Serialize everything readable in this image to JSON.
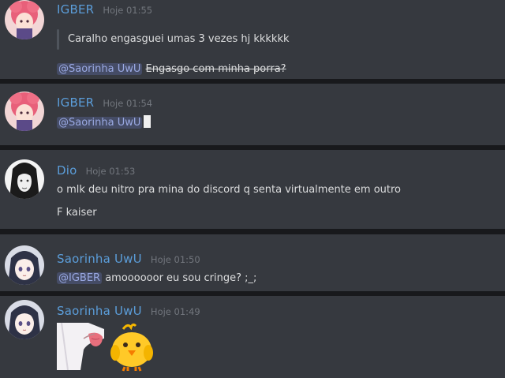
{
  "messages": [
    {
      "username": "IGBER",
      "timestamp": "Hoje 01:55",
      "quote": "Caralho engasguei umas 3 vezes hj kkkkkk",
      "mention": "@Saorinha UwU",
      "strikethrough": "Engasgo com minha porra?"
    },
    {
      "username": "IGBER",
      "timestamp": "Hoje 01:54",
      "mention": "@Saorinha UwU",
      "emoji_suffix": "❤️"
    },
    {
      "username": "Dio",
      "timestamp": "Hoje 01:53",
      "lines": [
        "o mlk deu nitro pra mina do discord  q senta virtualmente em outro",
        "F kaiser"
      ]
    },
    {
      "username": "Saorinha UwU",
      "timestamp": "Hoje 01:50",
      "mention": "@IGBER",
      "text": "amoooooor eu sou cringe? ;_;"
    },
    {
      "username": "Saorinha UwU",
      "timestamp": "Hoje 01:49",
      "stickers": [
        "tongue-sticker",
        "chick-emoji"
      ]
    }
  ],
  "colors": {
    "background": "#36393f",
    "separator": "#18191c",
    "username": "#5b9dd9",
    "timestamp": "#72767d",
    "text": "#dcddde",
    "mention_bg": "#3d4270"
  }
}
